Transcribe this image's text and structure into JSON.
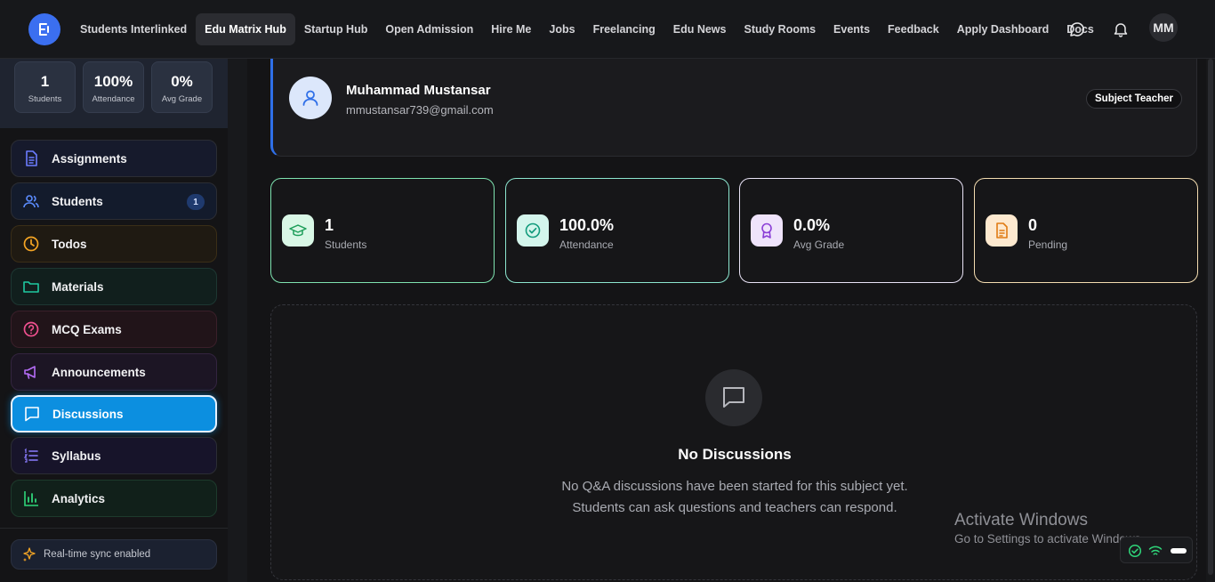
{
  "nav": {
    "items": [
      {
        "label": "Students Interlinked",
        "active": false
      },
      {
        "label": "Edu Matrix Hub",
        "active": true
      },
      {
        "label": "Startup Hub",
        "active": false
      },
      {
        "label": "Open Admission",
        "active": false
      },
      {
        "label": "Hire Me",
        "active": false
      },
      {
        "label": "Jobs",
        "active": false
      },
      {
        "label": "Freelancing",
        "active": false
      },
      {
        "label": "Edu News",
        "active": false
      },
      {
        "label": "Study Rooms",
        "active": false
      },
      {
        "label": "Events",
        "active": false
      },
      {
        "label": "Feedback",
        "active": false
      },
      {
        "label": "Apply Dashboard",
        "active": false
      },
      {
        "label": "Docs",
        "active": false
      }
    ],
    "avatar_initials": "MM",
    "icons": [
      "chat-icon",
      "bell-icon"
    ]
  },
  "sidebar": {
    "mini_stats": [
      {
        "value": "1",
        "label": "Students"
      },
      {
        "value": "100%",
        "label": "Attendance"
      },
      {
        "value": "0%",
        "label": "Avg Grade"
      }
    ],
    "items": [
      {
        "label": "Assignments",
        "icon": "document-icon",
        "color": "#6b7cff"
      },
      {
        "label": "Students",
        "icon": "users-icon",
        "color": "#5b8cff",
        "badge": "1"
      },
      {
        "label": "Todos",
        "icon": "clock-icon",
        "color": "#f5a524"
      },
      {
        "label": "Materials",
        "icon": "folder-icon",
        "color": "#1fc8a0"
      },
      {
        "label": "MCQ Exams",
        "icon": "question-icon",
        "color": "#f0508f"
      },
      {
        "label": "Announcements",
        "icon": "megaphone-icon",
        "color": "#b46cf5"
      },
      {
        "label": "Discussions",
        "icon": "message-icon",
        "color": "#ffffff",
        "active": true
      },
      {
        "label": "Syllabus",
        "icon": "list-icon",
        "color": "#8a7cff"
      },
      {
        "label": "Analytics",
        "icon": "bar-chart-icon",
        "color": "#2fd67a"
      }
    ],
    "sync_text": "Real-time sync enabled"
  },
  "profile": {
    "name": "Muhammad Mustansar",
    "email": "mmustansar739@gmail.com",
    "role": "Subject Teacher"
  },
  "stats": [
    {
      "value": "1",
      "label": "Students",
      "icon": "graduation-cap-icon",
      "accent": "#7ee3b0",
      "icon_bg": "#d9f7e6",
      "icon_color": "#1e9e5a"
    },
    {
      "value": "100.0%",
      "label": "Attendance",
      "icon": "check-circle-icon",
      "accent": "#8ce6cf",
      "icon_bg": "#d4f5ec",
      "icon_color": "#129b7c"
    },
    {
      "value": "0.0%",
      "label": "Avg Grade",
      "icon": "award-icon",
      "accent": "#e8e2f5",
      "icon_bg": "#efe3fb",
      "icon_color": "#8b3fd6"
    },
    {
      "value": "0",
      "label": "Pending",
      "icon": "file-icon",
      "accent": "#f3dcb0",
      "icon_bg": "#fde9cf",
      "icon_color": "#e07b12"
    }
  ],
  "empty": {
    "title": "No Discussions",
    "line1": "No Q&A discussions have been started for this subject yet.",
    "line2": "Students can ask questions and teachers can respond."
  },
  "watermark": {
    "title": "Activate Windows",
    "subtitle": "Go to Settings to activate Windows."
  }
}
